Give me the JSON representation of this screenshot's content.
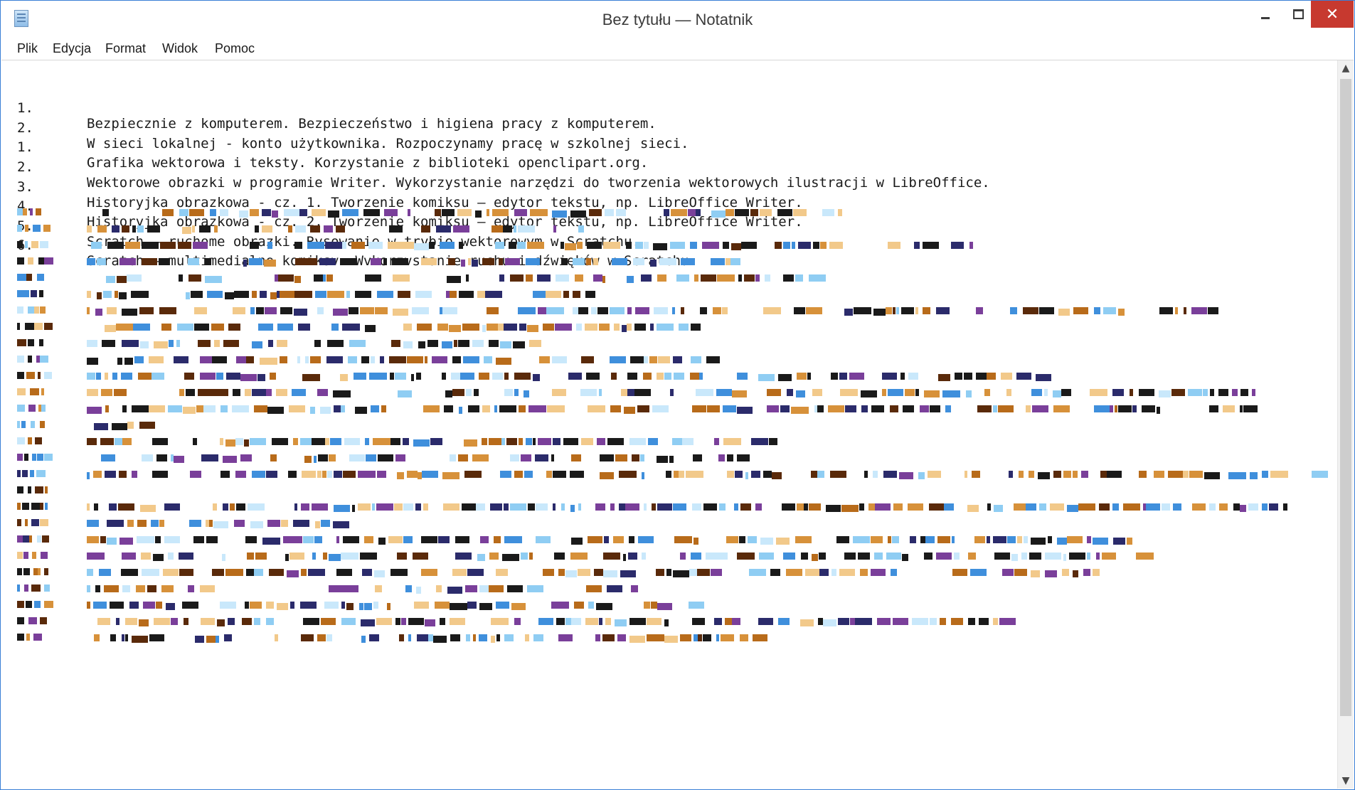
{
  "window": {
    "title": "Bez tytułu — Notatnik",
    "icon": "notepad-icon",
    "controls": {
      "minimize_icon": "minimize-icon",
      "maximize_icon": "maximize-icon",
      "close_label": "✕"
    }
  },
  "menu": {
    "items": [
      "Plik",
      "Edycja",
      "Format",
      "Widok",
      "Pomoc"
    ]
  },
  "editor": {
    "lines": [
      {
        "num": "1.",
        "text": "Bezpiecznie z komputerem. Bezpieczeństwo i higiena pracy z komputerem."
      },
      {
        "num": "2.",
        "text": "W sieci lokalnej - konto użytkownika. Rozpoczynamy pracę w szkolnej sieci."
      },
      {
        "num": "1.",
        "text": "Grafika wektorowa i teksty. Korzystanie z biblioteki openclipart.org."
      },
      {
        "num": "2.",
        "text": "Wektorowe obrazki w programie Writer. Wykorzystanie narzędzi do tworzenia wektorowych ilustracji w LibreOffice."
      },
      {
        "num": "3.",
        "text": "Historyjka obrazkowa - cz. 1. Tworzenie komiksu – edytor tekstu, np. LibreOffice Writer."
      },
      {
        "num": "4.",
        "text": "Historyjka obrazkowa - cz. 2. Tworzenie komiksu – edytor tekstu, np. LibreOffice Writer."
      },
      {
        "num": "5.",
        "text": "Scratch – ruchome obrazki. Rysowanie w trybie wektorowym w Scratchu."
      },
      {
        "num": "6.",
        "text": "Scratch – multimedialne komiksv. Wvkorzvstanie ruchu i dźwięków w Scratchu."
      }
    ]
  },
  "scrollbar": {
    "up_icon": "▲",
    "down_icon": "▼"
  },
  "colors": {
    "close_button": "#c7392f",
    "window_border": "#3a7fd6",
    "text": "#1a1a1a"
  }
}
